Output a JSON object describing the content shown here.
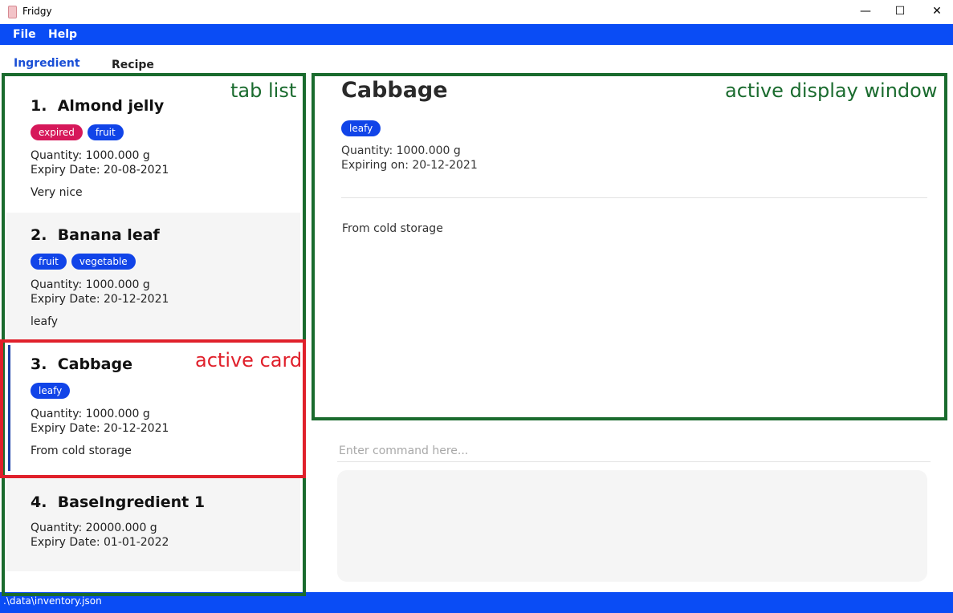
{
  "window": {
    "title": "Fridgy",
    "controls": {
      "minimize": "—",
      "maximize": "☐",
      "close": "✕"
    }
  },
  "menu": {
    "file": "File",
    "help": "Help"
  },
  "tabs": {
    "ingredient": "Ingredient",
    "recipe": "Recipe"
  },
  "list": [
    {
      "index": "1.",
      "name": "Almond jelly",
      "tags": [
        "expired",
        "fruit"
      ],
      "quantity": "Quantity: 1000.000 g",
      "expiry": "Expiry Date: 20-08-2021",
      "notes": "Very nice"
    },
    {
      "index": "2.",
      "name": "Banana leaf",
      "tags": [
        "fruit",
        "vegetable"
      ],
      "quantity": "Quantity: 1000.000 g",
      "expiry": "Expiry Date: 20-12-2021",
      "notes": "leafy"
    },
    {
      "index": "3.",
      "name": "Cabbage",
      "tags": [
        "leafy"
      ],
      "quantity": "Quantity: 1000.000 g",
      "expiry": "Expiry Date: 20-12-2021",
      "notes": "From cold storage"
    },
    {
      "index": "4.",
      "name": "BaseIngredient 1",
      "tags": [],
      "quantity": "Quantity: 20000.000 g",
      "expiry": "Expiry Date: 01-01-2022",
      "notes": ""
    }
  ],
  "detail": {
    "name": "Cabbage",
    "tag": "leafy",
    "quantity": "Quantity: 1000.000 g",
    "expiring": "Expiring on: 20-12-2021",
    "notes": "From cold storage"
  },
  "command": {
    "placeholder": "Enter command here..."
  },
  "status": {
    "path": ".\\data\\inventory.json"
  },
  "annotations": {
    "tab_list": "tab list",
    "active_card": "active card",
    "active_display": "active display window"
  },
  "colors": {
    "accent": "#0a4cf5",
    "tag_blue": "#1144e8",
    "tag_red": "#d6185a",
    "annotation_green": "#1a6b2e",
    "annotation_red": "#e0202b"
  }
}
